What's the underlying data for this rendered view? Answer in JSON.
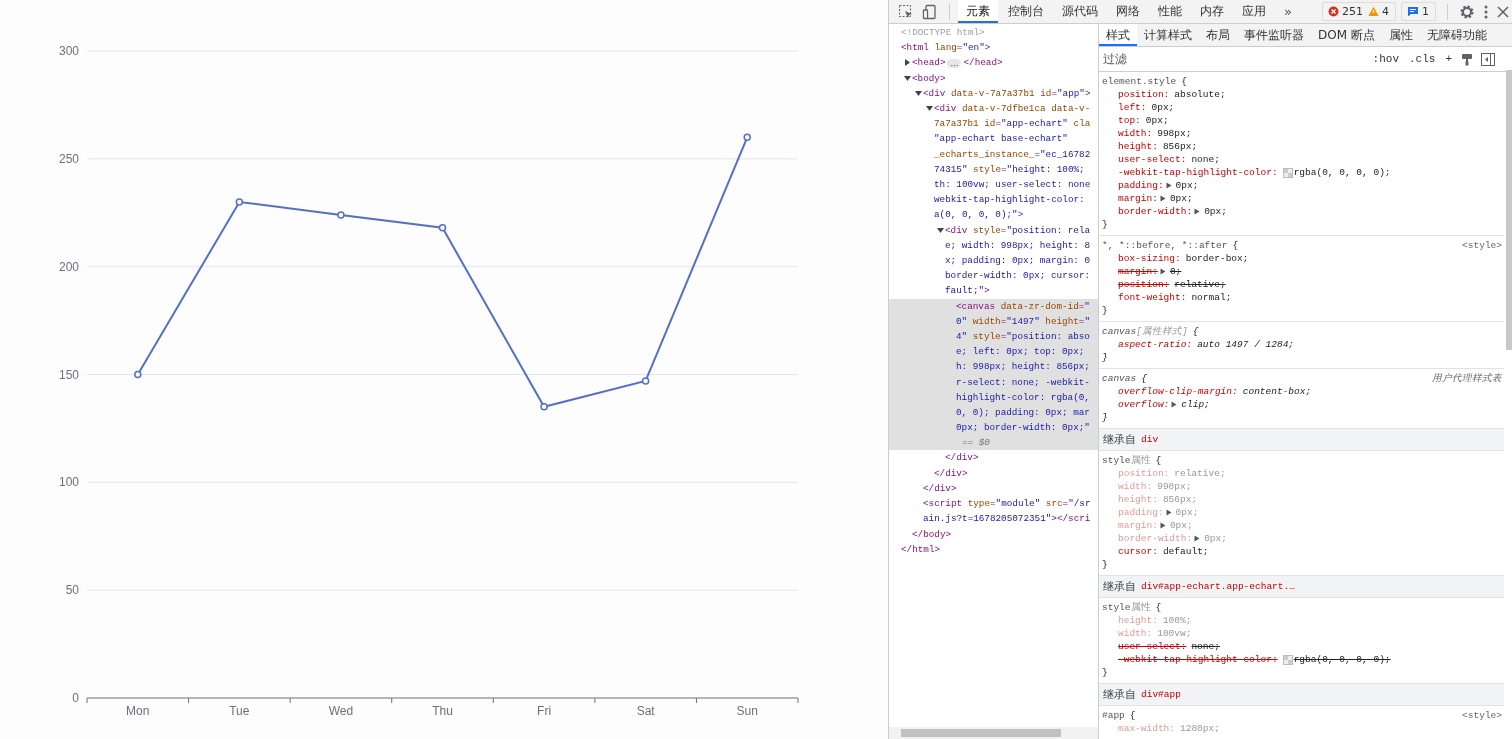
{
  "chart": {
    "chart_data": {
      "type": "line",
      "grid": true,
      "categories": [
        "Mon",
        "Tue",
        "Wed",
        "Thu",
        "Fri",
        "Sat",
        "Sun"
      ],
      "series": [
        {
          "color": "#5470c6",
          "marker": "circle",
          "values": [
            150,
            230,
            224,
            218,
            135,
            147,
            260
          ]
        }
      ],
      "ylim": [
        0,
        300
      ],
      "yticks": [
        0,
        50,
        100,
        150,
        200,
        250,
        300
      ]
    }
  },
  "devtools": {
    "toolbar": {
      "tabs": [
        {
          "label": "元素",
          "selected": true
        },
        {
          "label": "控制台",
          "selected": false
        },
        {
          "label": "源代码",
          "selected": false
        },
        {
          "label": "网络",
          "selected": false
        },
        {
          "label": "性能",
          "selected": false
        },
        {
          "label": "内存",
          "selected": false
        },
        {
          "label": "应用",
          "selected": false
        }
      ],
      "more": "»",
      "errors": "251",
      "warnings": "4",
      "messages": "1"
    },
    "elements": {
      "nodes": [
        {
          "lines": [
            "<!DOCTYPE html>"
          ],
          "kind": "doctype",
          "selected": false
        },
        {
          "lines": [
            "<html lang=\"en\">"
          ],
          "kind": "tag",
          "selected": false,
          "close": "</html>",
          "children": [
            {
              "lines": [
                "<head>"
              ],
              "kind": "tag",
              "expanded": false,
              "selected": false,
              "badge": "…",
              "close": "</head>"
            },
            {
              "lines": [
                "<body>"
              ],
              "kind": "tag",
              "expanded": true,
              "selected": false,
              "close": "</body>",
              "children": [
                {
                  "lines": [
                    "<div data-v-7a7a37b1 id=\"app\">"
                  ],
                  "kind": "tag",
                  "expanded": true,
                  "selected": false,
                  "close": "</div>",
                  "children": [
                    {
                      "lines": [
                        "<div data-v-7dfbe1ca data-v-",
                        "7a7a37b1 id=\"app-echart\" cla",
                        "\"app-echart base-echart\"",
                        "_echarts_instance_=\"ec_16782",
                        "74315\" style=\"height: 100%;",
                        "th: 100vw; user-select: none",
                        "webkit-tap-highlight-color:",
                        "a(0, 0, 0, 0);\">"
                      ],
                      "kind": "tag",
                      "expanded": true,
                      "selected": false,
                      "close": "</div>",
                      "children": [
                        {
                          "lines": [
                            "<div style=\"position: rela",
                            "e; width: 998px; height: 8",
                            "x; padding: 0px; margin: 0",
                            "border-width: 0px; cursor:",
                            "fault;\">"
                          ],
                          "kind": "tag",
                          "expanded": true,
                          "selected": false,
                          "close": "</div>",
                          "children": [
                            {
                              "lines": [
                                "<canvas data-zr-dom-id=\"",
                                "0\" width=\"1497\" height=\"",
                                "4\" style=\"position: abso",
                                "e; left: 0px; top: 0px; ",
                                "h: 998px; height: 856px;",
                                "r-select: none; -webkit-",
                                "highlight-color: rgba(0,",
                                "0, 0); padding: 0px; mar",
                                "0px; border-width: 0px;\""
                              ],
                              "kind": "tag",
                              "selected": true,
                              "marker": "== $0"
                            }
                          ]
                        }
                      ]
                    }
                  ]
                },
                {
                  "lines": [
                    "<script type=\"module\" src=\"/sr",
                    "ain.js?t=1678205072351\"></scri"
                  ],
                  "kind": "tag",
                  "selected": false
                }
              ]
            }
          ]
        }
      ]
    },
    "styles": {
      "tabs": [
        {
          "label": "样式",
          "selected": true
        },
        {
          "label": "计算样式",
          "selected": false
        },
        {
          "label": "布局",
          "selected": false
        },
        {
          "label": "事件监听器",
          "selected": false
        },
        {
          "label": "DOM 断点",
          "selected": false
        },
        {
          "label": "属性",
          "selected": false
        },
        {
          "label": "无障碍功能",
          "selected": false
        }
      ],
      "filter": {
        "placeholder": "过滤"
      },
      "buttons": [
        ":hov",
        ".cls",
        "+"
      ],
      "rules": [
        {
          "kind": "rule",
          "selector": "element.style",
          "open": "{",
          "close": "}",
          "italic": false,
          "decls": [
            {
              "prop": "position:",
              "value": "absolute;",
              "struck": false,
              "dim": false
            },
            {
              "prop": "left:",
              "value": "0px;",
              "struck": false,
              "dim": false
            },
            {
              "prop": "top:",
              "value": "0px;",
              "struck": false,
              "dim": false
            },
            {
              "prop": "width:",
              "value": "998px;",
              "struck": false,
              "dim": false
            },
            {
              "prop": "height:",
              "value": "856px;",
              "struck": false,
              "dim": false
            },
            {
              "prop": "user-select:",
              "value": "none;",
              "struck": false,
              "dim": false
            },
            {
              "prop": "-webkit-tap-highlight-color:",
              "value": "rgba(0, 0, 0, 0);",
              "swatch": true,
              "struck": false,
              "dim": false
            },
            {
              "prop": "padding:",
              "value": "0px;",
              "arrow": true,
              "struck": false,
              "dim": false
            },
            {
              "prop": "margin:",
              "value": "0px;",
              "arrow": true,
              "struck": false,
              "dim": false
            },
            {
              "prop": "border-width:",
              "value": "0px;",
              "arrow": true,
              "struck": false,
              "dim": false
            }
          ]
        },
        {
          "kind": "rule",
          "selector": "*, *::before, *::after",
          "open": "{",
          "close": "}",
          "source": "<style>",
          "italic": false,
          "decls": [
            {
              "prop": "box-sizing:",
              "value": "border-box;",
              "struck": false,
              "dim": false
            },
            {
              "prop": "margin:",
              "value": "0;",
              "arrow": true,
              "struck": true,
              "dim": false
            },
            {
              "prop": "position:",
              "value": "relative;",
              "struck": true,
              "dim": false
            },
            {
              "prop": "font-weight:",
              "value": "normal;",
              "struck": false,
              "dim": false
            }
          ]
        },
        {
          "kind": "rule",
          "selector": "canvas",
          "note": "[属性样式]",
          "open": "{",
          "close": "}",
          "italic": true,
          "decls": [
            {
              "prop": "aspect-ratio:",
              "value": "auto 1497 / 1284;",
              "struck": false,
              "dim": false
            }
          ]
        },
        {
          "kind": "rule",
          "selector": "canvas",
          "open": "{",
          "close": "}",
          "source": "用户代理样式表",
          "italic": true,
          "decls": [
            {
              "prop": "overflow-clip-margin:",
              "value": "content-box;",
              "struck": false,
              "dim": false
            },
            {
              "prop": "overflow:",
              "value": "clip;",
              "arrow": true,
              "struck": false,
              "dim": false
            }
          ]
        },
        {
          "kind": "inherited",
          "label": "继承自",
          "target": "div"
        },
        {
          "kind": "rule",
          "selector": "style",
          "note": "属性",
          "open": "{",
          "close": "}",
          "italic": false,
          "decls": [
            {
              "prop": "position:",
              "value": "relative;",
              "struck": false,
              "dim": true
            },
            {
              "prop": "width:",
              "value": "998px;",
              "struck": false,
              "dim": true
            },
            {
              "prop": "height:",
              "value": "856px;",
              "struck": false,
              "dim": true
            },
            {
              "prop": "padding:",
              "value": "0px;",
              "arrow": true,
              "struck": false,
              "dim": true
            },
            {
              "prop": "margin:",
              "value": "0px;",
              "arrow": true,
              "struck": false,
              "dim": true
            },
            {
              "prop": "border-width:",
              "value": "0px;",
              "arrow": true,
              "struck": false,
              "dim": true
            },
            {
              "prop": "cursor:",
              "value": "default;",
              "struck": false,
              "dim": false
            }
          ]
        },
        {
          "kind": "inherited",
          "label": "继承自",
          "target": "div#app-echart.app-echart.…"
        },
        {
          "kind": "rule",
          "selector": "style",
          "note": "属性",
          "open": "{",
          "close": "}",
          "italic": false,
          "decls": [
            {
              "prop": "height:",
              "value": "100%;",
              "struck": false,
              "dim": true
            },
            {
              "prop": "width:",
              "value": "100vw;",
              "struck": false,
              "dim": true
            },
            {
              "prop": "user-select:",
              "value": "none;",
              "struck": true,
              "dim": false
            },
            {
              "prop": "-webkit-tap-highlight-color:",
              "value": "rgba(0, 0, 0, 0);",
              "swatch": true,
              "struck": true,
              "dim": false
            }
          ]
        },
        {
          "kind": "inherited",
          "label": "继承自",
          "target": "div#app"
        },
        {
          "kind": "rule",
          "selector": "#app",
          "open": "{",
          "source": "<style>",
          "italic": false,
          "decls": [
            {
              "prop": "max-width:",
              "value": "1280px;",
              "struck": false,
              "dim": true
            }
          ]
        }
      ]
    }
  }
}
